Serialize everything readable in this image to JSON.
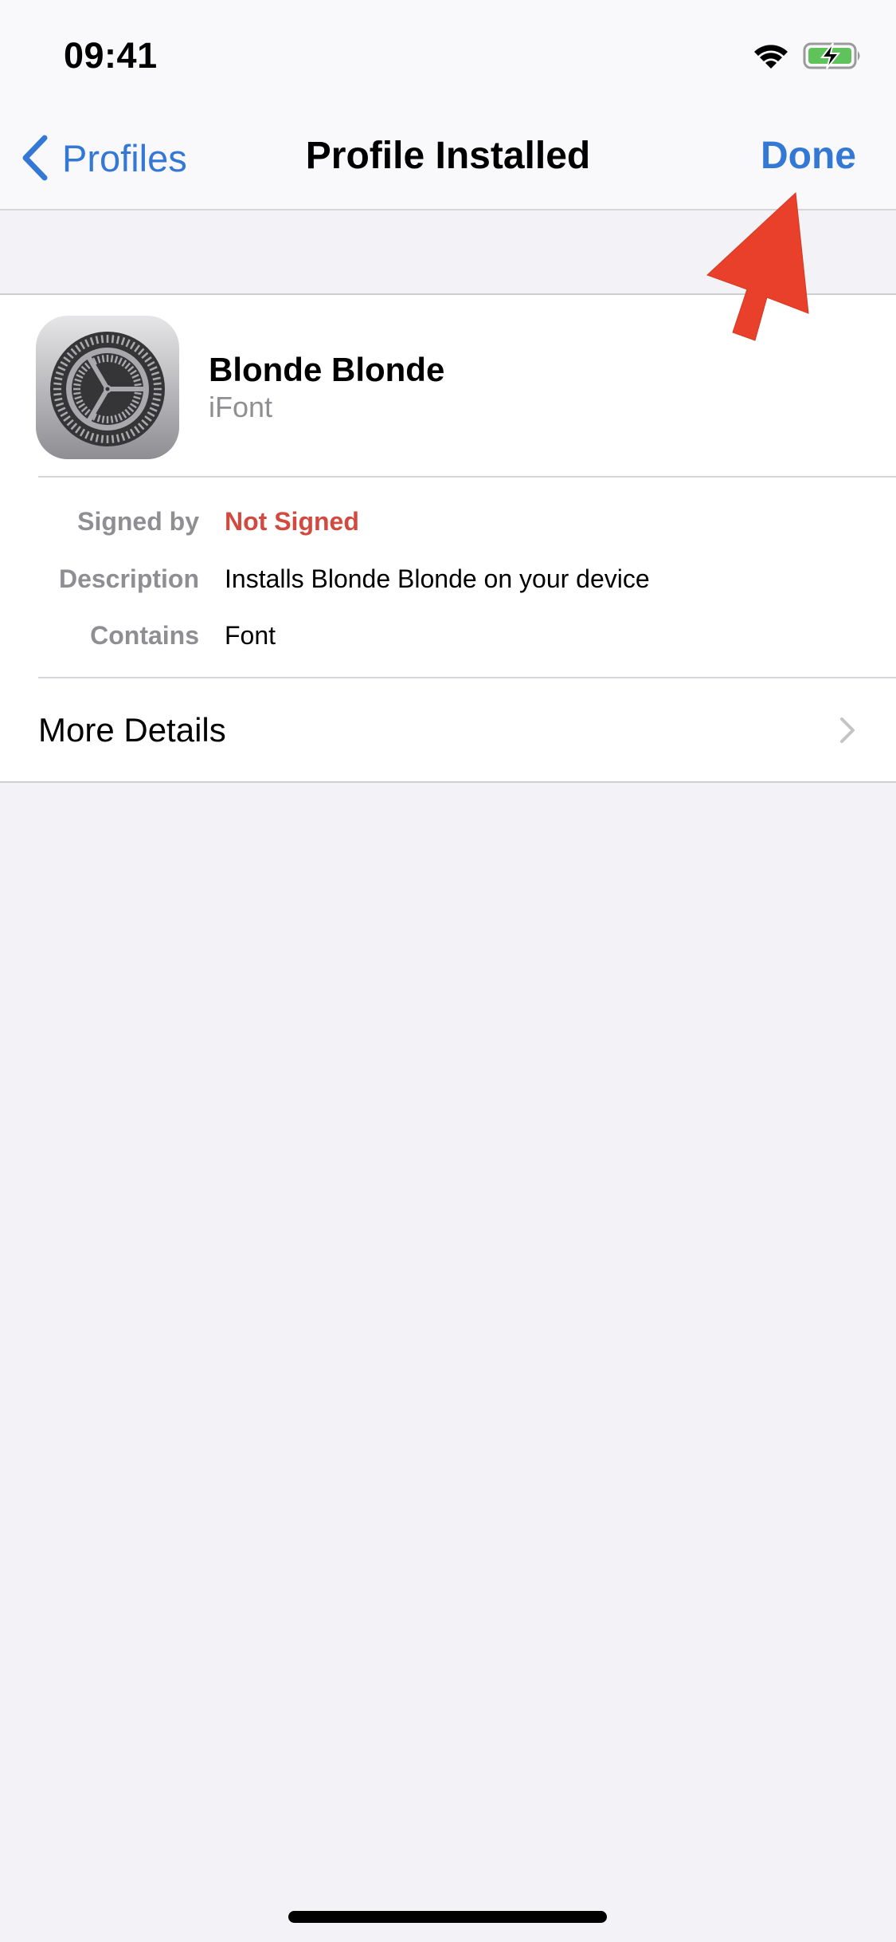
{
  "status_bar": {
    "time": "09:41",
    "wifi_icon": "wifi-icon",
    "battery_icon": "battery-charging-icon",
    "battery_color": "#5fc25b"
  },
  "nav": {
    "back_label": "Profiles",
    "back_icon": "chevron-left-icon",
    "title": "Profile Installed",
    "done_label": "Done",
    "accent_color": "#3478d6"
  },
  "profile": {
    "icon": "settings-gear-icon",
    "name": "Blonde Blonde",
    "organization": "iFont"
  },
  "details": [
    {
      "label": "Signed by",
      "value": "Not Signed",
      "status": "danger"
    },
    {
      "label": "Description",
      "value": "Installs Blonde Blonde on your device",
      "status": "normal"
    },
    {
      "label": "Contains",
      "value": "Font",
      "status": "normal"
    }
  ],
  "more_details": {
    "label": "More Details",
    "icon": "chevron-right-icon"
  },
  "annotation": {
    "icon": "red-arrow-pointer-icon",
    "color": "#e8402a",
    "points_to": "Done"
  },
  "colors": {
    "danger": "#d24a3f",
    "secondary_text": "#8e8e93",
    "background": "#f2f2f7"
  }
}
